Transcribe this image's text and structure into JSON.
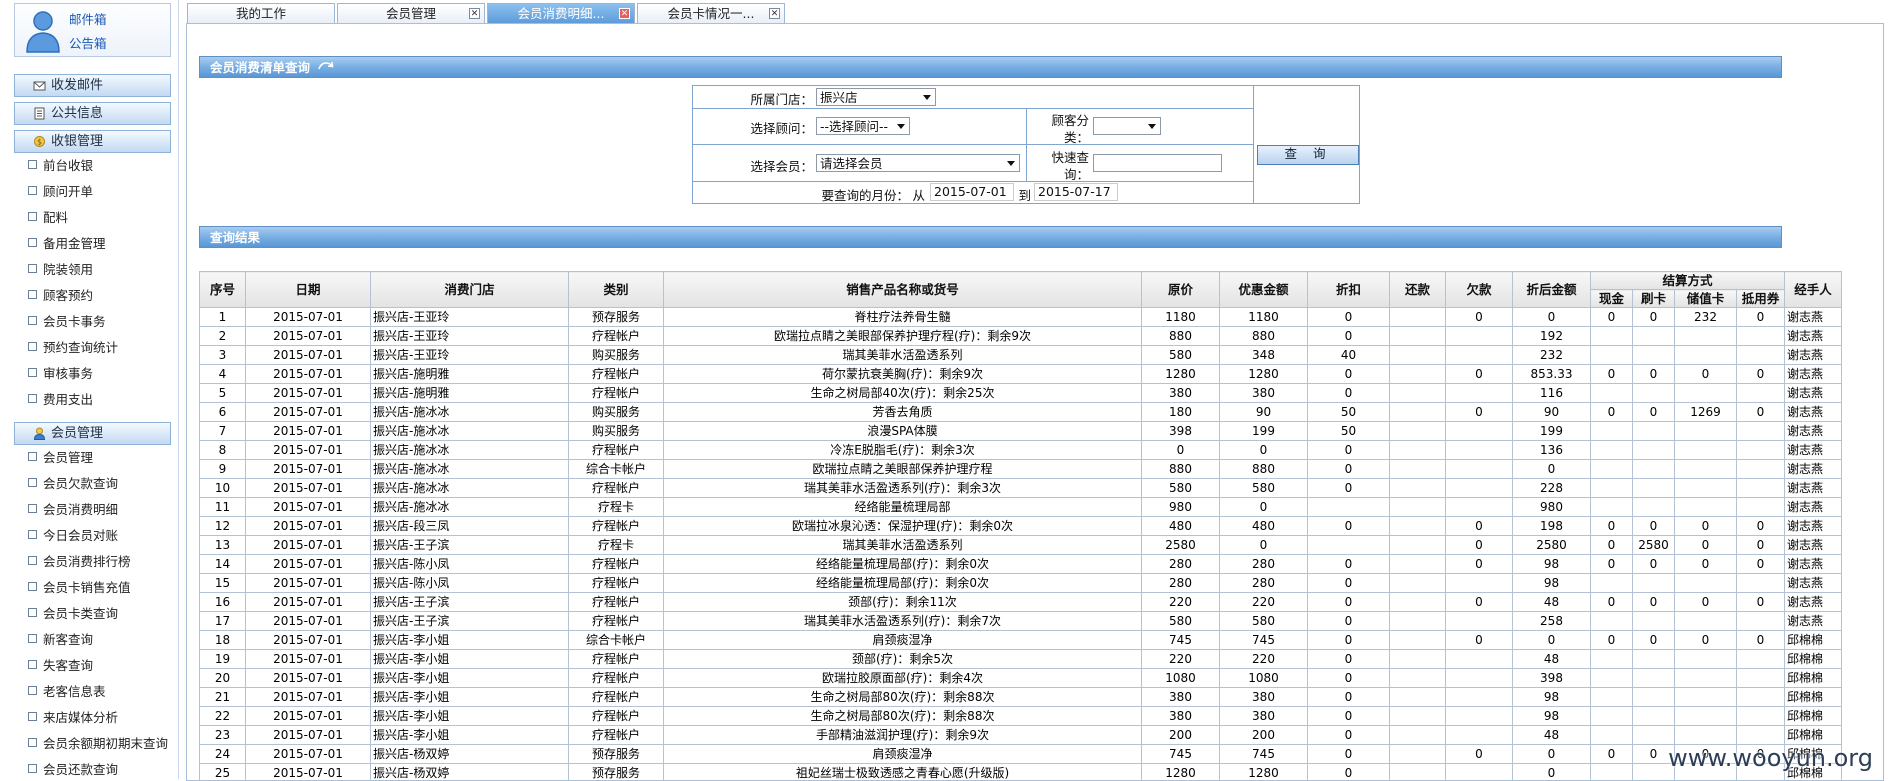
{
  "sidebar": {
    "mailbox": {
      "inbox": "邮件箱",
      "notice": "公告箱"
    },
    "groups": [
      {
        "label": "收发邮件",
        "icon": "mail-icon"
      },
      {
        "label": "公共信息",
        "icon": "document-icon"
      },
      {
        "label": "收银管理",
        "icon": "money-icon",
        "items": [
          "前台收银",
          "顾问开单",
          "配料",
          "备用金管理",
          "院装领用",
          "顾客预约",
          "会员卡事务",
          "预约查询统计",
          "审核事务",
          "费用支出"
        ]
      },
      {
        "label": "会员管理",
        "icon": "user-icon",
        "items": [
          "会员管理",
          "会员欠款查询",
          "会员消费明细",
          "今日会员对账",
          "会员消费排行榜",
          "会员卡销售充值",
          "会员卡类查询",
          "新客查询",
          "失客查询",
          "老客信息表",
          "来店媒体分析",
          "会员余额期初期末查询",
          "会员还款查询"
        ]
      }
    ]
  },
  "tabs": [
    {
      "label": "我的工作",
      "closable": false,
      "active": false
    },
    {
      "label": "会员管理",
      "closable": true,
      "active": false
    },
    {
      "label": "会员消费明细...",
      "closable": true,
      "active": true
    },
    {
      "label": "会员卡情况一...",
      "closable": true,
      "active": false
    }
  ],
  "query": {
    "title": "会员消费清单查询",
    "store_label": "所属门店：",
    "store_value": "振兴店",
    "advisor_label": "选择顾问：",
    "advisor_value": "--选择顾问--",
    "category_label_1": "顾客分",
    "category_label_2": "类：",
    "category_value": "",
    "member_label": "选择会员：",
    "member_value": "请选择会员",
    "quick_label_1": "快速查",
    "quick_label_2": "询：",
    "quick_value": "",
    "button": "查 询",
    "month_label": "要查询的月份：",
    "from_label": "从",
    "from_value": "2015-07-01",
    "to_label": "到",
    "to_value": "2015-07-17"
  },
  "results": {
    "title": "查询结果",
    "headers": {
      "seq": "序号",
      "date": "日期",
      "store": "消费门店",
      "type": "类别",
      "product": "销售产品名称或货号",
      "orig": "原价",
      "discount_amt": "优惠金额",
      "discount": "折扣",
      "repay": "还款",
      "debt": "欠款",
      "final": "折后金额",
      "settle": "结算方式",
      "cash": "现金",
      "card": "刷卡",
      "stored": "储值卡",
      "voucher": "抵用券",
      "handler": "经手人"
    },
    "rows": [
      [
        "1",
        "2015-07-01",
        "振兴店-王亚玲",
        "预存服务",
        "脊柱疗法养骨生髓",
        "1180",
        "1180",
        "0",
        "",
        "0",
        "0",
        "0",
        "0",
        "232",
        "0",
        "谢志燕"
      ],
      [
        "2",
        "2015-07-01",
        "振兴店-王亚玲",
        "疗程帐户",
        "欧瑞拉点睛之美眼部保养护理疗程(疗)：剩余9次",
        "880",
        "880",
        "0",
        "",
        "",
        "192",
        "",
        "",
        "",
        "",
        "谢志燕"
      ],
      [
        "3",
        "2015-07-01",
        "振兴店-王亚玲",
        "购买服务",
        "瑞其美菲水活盈透系列",
        "580",
        "348",
        "40",
        "",
        "",
        "232",
        "",
        "",
        "",
        "",
        "谢志燕"
      ],
      [
        "4",
        "2015-07-01",
        "振兴店-施明雅",
        "疗程帐户",
        "荷尔蒙抗衰美胸(疗)：剩余9次",
        "1280",
        "1280",
        "0",
        "",
        "0",
        "853.33",
        "0",
        "0",
        "0",
        "0",
        "谢志燕"
      ],
      [
        "5",
        "2015-07-01",
        "振兴店-施明雅",
        "疗程帐户",
        "生命之树局部40次(疗)：剩余25次",
        "380",
        "380",
        "0",
        "",
        "",
        "116",
        "",
        "",
        "",
        "",
        "谢志燕"
      ],
      [
        "6",
        "2015-07-01",
        "振兴店-施冰冰",
        "购买服务",
        "芳香去角质",
        "180",
        "90",
        "50",
        "",
        "0",
        "90",
        "0",
        "0",
        "1269",
        "0",
        "谢志燕"
      ],
      [
        "7",
        "2015-07-01",
        "振兴店-施冰冰",
        "购买服务",
        "浪漫SPA体膜",
        "398",
        "199",
        "50",
        "",
        "",
        "199",
        "",
        "",
        "",
        "",
        "谢志燕"
      ],
      [
        "8",
        "2015-07-01",
        "振兴店-施冰冰",
        "疗程帐户",
        "冷冻E脱脂毛(疗)：剩余3次",
        "0",
        "0",
        "0",
        "",
        "",
        "136",
        "",
        "",
        "",
        "",
        "谢志燕"
      ],
      [
        "9",
        "2015-07-01",
        "振兴店-施冰冰",
        "综合卡帐户",
        "欧瑞拉点睛之美眼部保养护理疗程",
        "880",
        "880",
        "0",
        "",
        "",
        "0",
        "",
        "",
        "",
        "",
        "谢志燕"
      ],
      [
        "10",
        "2015-07-01",
        "振兴店-施冰冰",
        "疗程帐户",
        "瑞其美菲水活盈透系列(疗)：剩余3次",
        "580",
        "580",
        "0",
        "",
        "",
        "228",
        "",
        "",
        "",
        "",
        "谢志燕"
      ],
      [
        "11",
        "2015-07-01",
        "振兴店-施冰冰",
        "疗程卡",
        "经络能量梳理局部",
        "980",
        "0",
        "",
        "",
        "",
        "980",
        "",
        "",
        "",
        "",
        "谢志燕"
      ],
      [
        "12",
        "2015-07-01",
        "振兴店-段三凤",
        "疗程帐户",
        "欧瑞拉冰泉沁透：保湿护理(疗)：剩余0次",
        "480",
        "480",
        "0",
        "",
        "0",
        "198",
        "0",
        "0",
        "0",
        "0",
        "谢志燕"
      ],
      [
        "13",
        "2015-07-01",
        "振兴店-王子滨",
        "疗程卡",
        "瑞其美菲水活盈透系列",
        "2580",
        "0",
        "",
        "",
        "0",
        "2580",
        "0",
        "2580",
        "0",
        "0",
        "谢志燕"
      ],
      [
        "14",
        "2015-07-01",
        "振兴店-陈小凤",
        "疗程帐户",
        "经络能量梳理局部(疗)：剩余0次",
        "280",
        "280",
        "0",
        "",
        "0",
        "98",
        "0",
        "0",
        "0",
        "0",
        "谢志燕"
      ],
      [
        "15",
        "2015-07-01",
        "振兴店-陈小凤",
        "疗程帐户",
        "经络能量梳理局部(疗)：剩余0次",
        "280",
        "280",
        "0",
        "",
        "",
        "98",
        "",
        "",
        "",
        "",
        "谢志燕"
      ],
      [
        "16",
        "2015-07-01",
        "振兴店-王子滨",
        "疗程帐户",
        "颈部(疗)：剩余11次",
        "220",
        "220",
        "0",
        "",
        "0",
        "48",
        "0",
        "0",
        "0",
        "0",
        "谢志燕"
      ],
      [
        "17",
        "2015-07-01",
        "振兴店-王子滨",
        "疗程帐户",
        "瑞其美菲水活盈透系列(疗)：剩余7次",
        "580",
        "580",
        "0",
        "",
        "",
        "258",
        "",
        "",
        "",
        "",
        "谢志燕"
      ],
      [
        "18",
        "2015-07-01",
        "振兴店-李小姐",
        "综合卡帐户",
        "肩颈痰湿净",
        "745",
        "745",
        "0",
        "",
        "0",
        "0",
        "0",
        "0",
        "0",
        "0",
        "邱棉棉"
      ],
      [
        "19",
        "2015-07-01",
        "振兴店-李小姐",
        "疗程帐户",
        "颈部(疗)：剩余5次",
        "220",
        "220",
        "0",
        "",
        "",
        "48",
        "",
        "",
        "",
        "",
        "邱棉棉"
      ],
      [
        "20",
        "2015-07-01",
        "振兴店-李小姐",
        "疗程帐户",
        "欧瑞拉胶原面部(疗)：剩余4次",
        "1080",
        "1080",
        "0",
        "",
        "",
        "398",
        "",
        "",
        "",
        "",
        "邱棉棉"
      ],
      [
        "21",
        "2015-07-01",
        "振兴店-李小姐",
        "疗程帐户",
        "生命之树局部80次(疗)：剩余88次",
        "380",
        "380",
        "0",
        "",
        "",
        "98",
        "",
        "",
        "",
        "",
        "邱棉棉"
      ],
      [
        "22",
        "2015-07-01",
        "振兴店-李小姐",
        "疗程帐户",
        "生命之树局部80次(疗)：剩余88次",
        "380",
        "380",
        "0",
        "",
        "",
        "98",
        "",
        "",
        "",
        "",
        "邱棉棉"
      ],
      [
        "23",
        "2015-07-01",
        "振兴店-李小姐",
        "疗程帐户",
        "手部精油滋润护理(疗)：剩余9次",
        "200",
        "200",
        "0",
        "",
        "",
        "48",
        "",
        "",
        "",
        "",
        "邱棉棉"
      ],
      [
        "24",
        "2015-07-01",
        "振兴店-杨双婷",
        "预存服务",
        "肩颈痰湿净",
        "745",
        "745",
        "0",
        "",
        "0",
        "0",
        "0",
        "0",
        "0",
        "0",
        "邱棉棉"
      ],
      [
        "25",
        "2015-07-01",
        "振兴店-杨双婷",
        "预存服务",
        "祖妃丝瑞士极致透感之青春心愿(升级版)",
        "1280",
        "1280",
        "0",
        "",
        "",
        "0",
        "",
        "",
        "",
        "",
        "邱棉棉"
      ]
    ]
  },
  "watermark": "www.wooyun.org",
  "colors": {
    "accent": "#5a97d6",
    "active_tab": "#6ea9e0",
    "border": "#b4c3d4"
  }
}
